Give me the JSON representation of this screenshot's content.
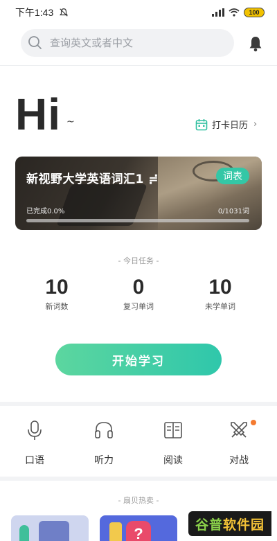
{
  "status": {
    "time": "下午1:43",
    "battery": "100"
  },
  "search": {
    "placeholder": "查询英文或者中文"
  },
  "greeting": {
    "hi": "Hi",
    "tilde": "~"
  },
  "calendar": {
    "label": "打卡日历",
    "chevron": "›"
  },
  "book": {
    "title": "新视野大学英语词汇1 ≓",
    "tag": "词表",
    "completed_label": "已完成0.0%",
    "progress": 0.0,
    "count_label": "0/1031词"
  },
  "tasks": {
    "label": "- 今日任务 -",
    "stats": [
      {
        "value": "10",
        "label": "新词数"
      },
      {
        "value": "0",
        "label": "复习单词"
      },
      {
        "value": "10",
        "label": "未学单词"
      }
    ]
  },
  "start_button": "开始学习",
  "features": [
    {
      "label": "口语",
      "icon": "microphone-icon"
    },
    {
      "label": "听力",
      "icon": "headphones-icon"
    },
    {
      "label": "阅读",
      "icon": "book-open-icon"
    },
    {
      "label": "对战",
      "icon": "swords-icon"
    }
  ],
  "hot": {
    "label": "- 扇贝热卖 -"
  },
  "watermark": {
    "part1": "谷普",
    "part2": "软件园"
  },
  "colors": {
    "accent": "#34c7a6",
    "button_start": "#5cd69f",
    "button_end": "#2fc7ab",
    "badge_dot": "#f47a30"
  }
}
